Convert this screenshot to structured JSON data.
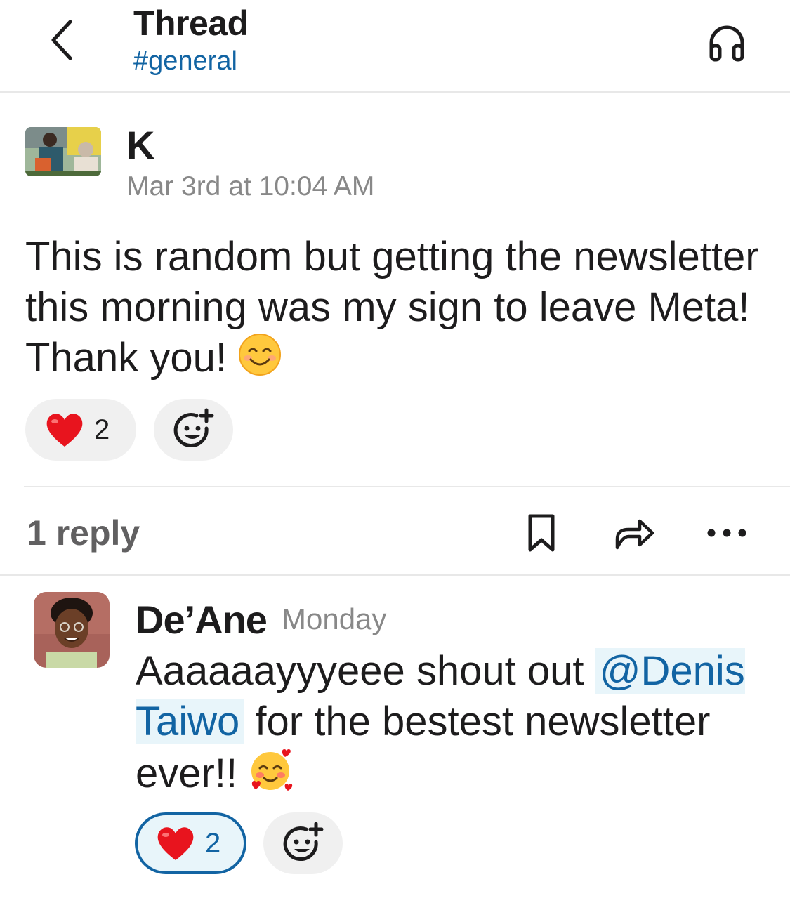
{
  "header": {
    "title": "Thread",
    "channel": "#general",
    "back_icon": "chevron-left-icon",
    "huddle_icon": "headphones-icon"
  },
  "parent_message": {
    "author": "K",
    "timestamp": "Mar 3rd at 10:04 AM",
    "text": "This is random but getting the newsletter this morning was my sign to leave Meta! Thank you!",
    "emoji": "smiling-face-icon",
    "reactions": [
      {
        "emoji": "red-heart-icon",
        "count": "2"
      }
    ],
    "add_reaction_icon": "add-reaction-icon"
  },
  "thread_bar": {
    "reply_count": "1 reply",
    "icons": [
      "bookmark-icon",
      "share-icon",
      "more-icon"
    ]
  },
  "reply": {
    "author": "De’Ane",
    "timestamp": "Monday",
    "text_before": "Aaaaaayyyeee shout out ",
    "mention": "@Denis Taiwo",
    "text_after": " for the bestest newsletter ever!!",
    "emoji": "smiling-face-with-hearts-icon",
    "reactions": [
      {
        "emoji": "red-heart-icon",
        "count": "2",
        "selected": true
      }
    ]
  },
  "colors": {
    "link": "#1264a3",
    "mention_bg": "#e8f5fa",
    "muted": "#888888",
    "divider": "#e8e8e8",
    "reaction_bg": "#f0f0f0"
  }
}
